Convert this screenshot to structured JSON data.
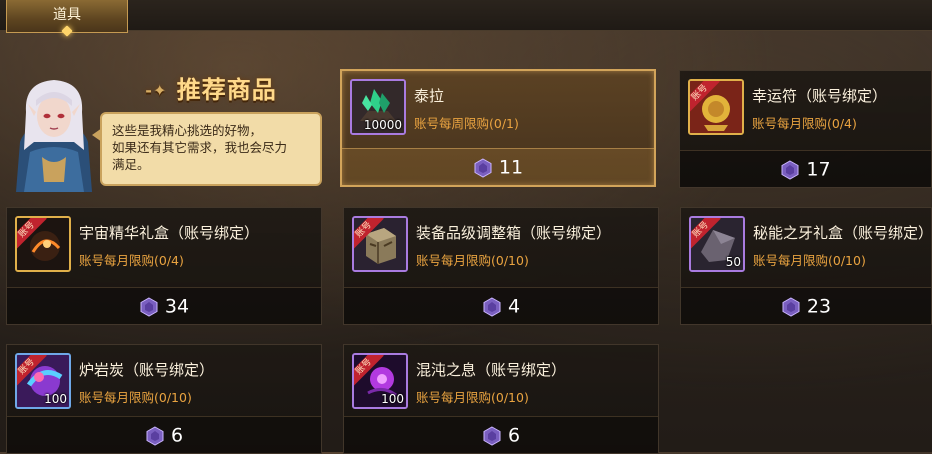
{
  "tab": {
    "label": "道具"
  },
  "recommend": {
    "title": "推荐商品",
    "message_lines": [
      "这些是我精心挑选的好物，",
      "如果还有其它需求，我也会尽力",
      "满足。"
    ]
  },
  "ribbon_text": "账号",
  "items": [
    {
      "name": "泰拉",
      "limit": "账号每周限购(0/1)",
      "price": "11",
      "qty": "10000",
      "icon": "tera-crystal-icon",
      "selected": true
    },
    {
      "name": "幸运符（账号绑定）",
      "limit": "账号每月限购(0/4)",
      "price": "17",
      "qty": "",
      "icon": "lucky-charm-icon"
    },
    {
      "name": "宇宙精华礼盒（账号绑定）",
      "limit": "账号每月限购(0/4)",
      "price": "34",
      "qty": "",
      "icon": "cosmic-essence-box-icon"
    },
    {
      "name": "装备品级调整箱（账号绑定）",
      "limit": "账号每月限购(0/10)",
      "price": "4",
      "qty": "",
      "icon": "grade-adjust-box-icon"
    },
    {
      "name": "秘能之牙礼盒（账号绑定）",
      "limit": "账号每月限购(0/10)",
      "price": "23",
      "qty": "50",
      "icon": "fang-box-icon"
    },
    {
      "name": "炉岩炭（账号绑定）",
      "limit": "账号每月限购(0/10)",
      "price": "6",
      "qty": "100",
      "icon": "lava-coal-icon"
    },
    {
      "name": "混沌之息（账号绑定）",
      "limit": "账号每月限购(0/10)",
      "price": "6",
      "qty": "100",
      "icon": "chaos-breath-icon"
    }
  ],
  "colors": {
    "accent_gold": "#d2a45a",
    "limit_orange": "#e9a340",
    "rarity_purple": "#a97be0"
  }
}
